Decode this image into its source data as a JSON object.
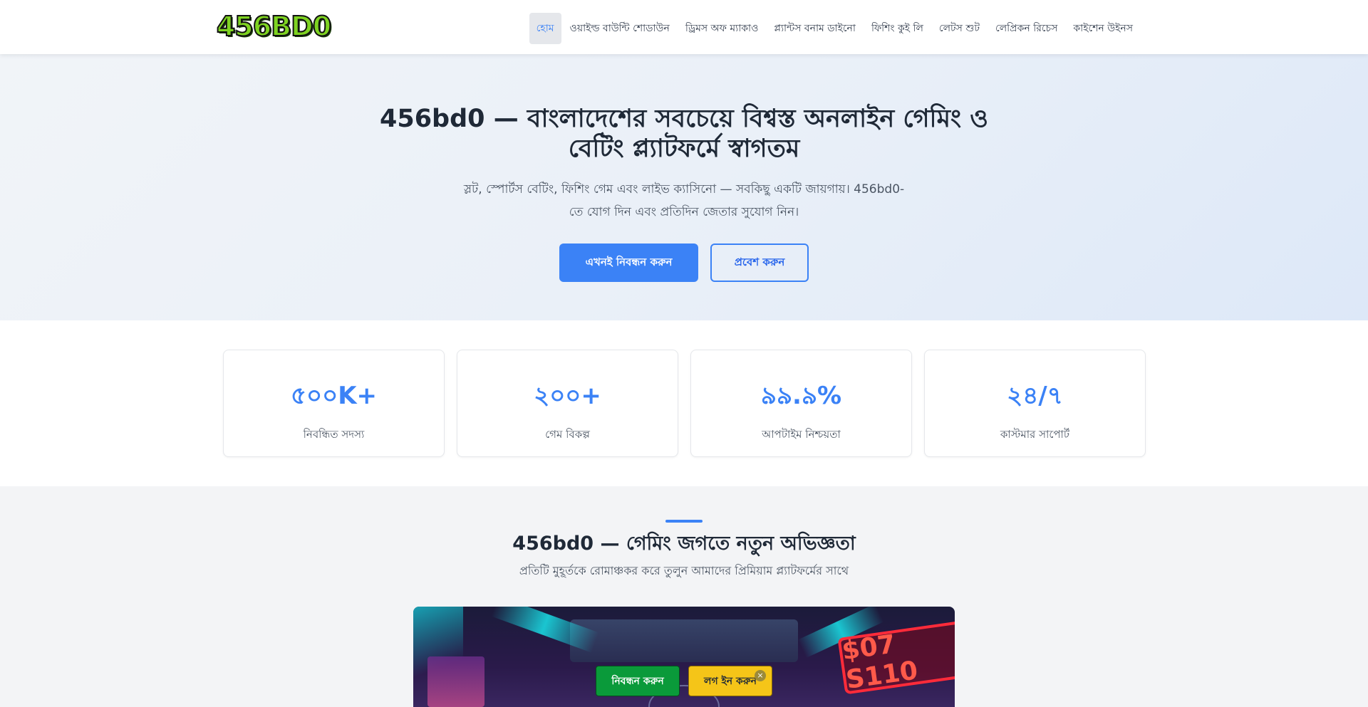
{
  "brand": {
    "logo_text": "456BD0"
  },
  "nav": {
    "items": [
      {
        "label": "হোম",
        "active": true
      },
      {
        "label": "ওয়াইল্ড বাউন্টি শোডাউন"
      },
      {
        "label": "ড্রিমস অফ ম্যাকাও"
      },
      {
        "label": "প্ল্যান্টস বনাম ডাইনো"
      },
      {
        "label": "ফিশিং কুই লি"
      },
      {
        "label": "লেটস শুট"
      },
      {
        "label": "লেপ্রিকন রিচেস"
      },
      {
        "label": "কাইশেন উইনস"
      }
    ]
  },
  "hero": {
    "title_line1": "456bd0 — বাংলাদেশের সবচেয়ে বিশ্বস্ত অনলাইন গেমিং ও",
    "title_line2": "বেটিং প্ল্যাটফর্মে স্বাগতম",
    "subtitle_line1": "স্লট, স্পোর্টস বেটিং, ফিশিং গেম এবং লাইভ ক্যাসিনো — সবকিছু একটি জায়গায়। 456bd0-",
    "subtitle_line2": "তে যোগ দিন এবং প্রতিদিন জেতার সুযোগ নিন।",
    "register_label": "এখনই নিবন্ধন করুন",
    "login_label": "প্রবেশ করুন"
  },
  "stats": [
    {
      "value": "৫০০K+",
      "label": "নিবন্ধিত সদস্য"
    },
    {
      "value": "২০০+",
      "label": "গেম বিকল্প"
    },
    {
      "value": "৯৯.৯%",
      "label": "আপটাইম নিশ্চয়তা"
    },
    {
      "value": "২৪/৭",
      "label": "কাস্টমার সাপোর্ট"
    }
  ],
  "section": {
    "title": "456bd0 — গেমিং জগতে নতুন অভিজ্ঞতা",
    "subtitle": "প্রতিটি মুহূর্তকে রোমাঞ্চকর করে তুলুন আমাদের প্রিমিয়াম প্ল্যাটফর্মের সাথে"
  },
  "banner": {
    "sign_text": "$07 S110"
  },
  "floating": {
    "register_label": "নিবন্ধন করুন",
    "login_label": "লগ ইন করুন",
    "close_symbol": "×"
  },
  "colors": {
    "accent": "#3b82f6",
    "register_green": "#0a9a3a",
    "login_yellow": "#f5c518"
  }
}
